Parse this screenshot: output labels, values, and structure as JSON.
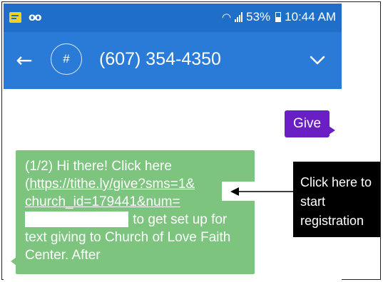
{
  "status_bar": {
    "battery": "53%",
    "time": "10:44 AM",
    "icons": [
      "message-notification-icon",
      "voicemail-icon",
      "wifi-icon",
      "signal-icon",
      "battery-icon"
    ]
  },
  "app_bar": {
    "back_icon": "←",
    "avatar_glyph": "#",
    "title": "(607) 354-4350",
    "expand_icon": "chevron-down-icon"
  },
  "messages": {
    "sent": [
      {
        "text": "Give"
      }
    ],
    "received": [
      {
        "prefix": "(1/2) Hi there! Click here (",
        "link_line1": "https://tithe.ly/give?sms=1&",
        "link_line2": "church_id=179441&num=",
        "suffix": " to get set up for text giving to Church of Love Faith Center. After"
      }
    ]
  },
  "annotation": {
    "line1": "Click here to",
    "line2": "start",
    "line3": "registration"
  },
  "colors": {
    "status_bar": "#1f6fc8",
    "app_bar": "#2a7bd8",
    "sent_bubble": "#6a1fc4",
    "received_bubble": "#7dc57f",
    "callout": "#000000"
  }
}
